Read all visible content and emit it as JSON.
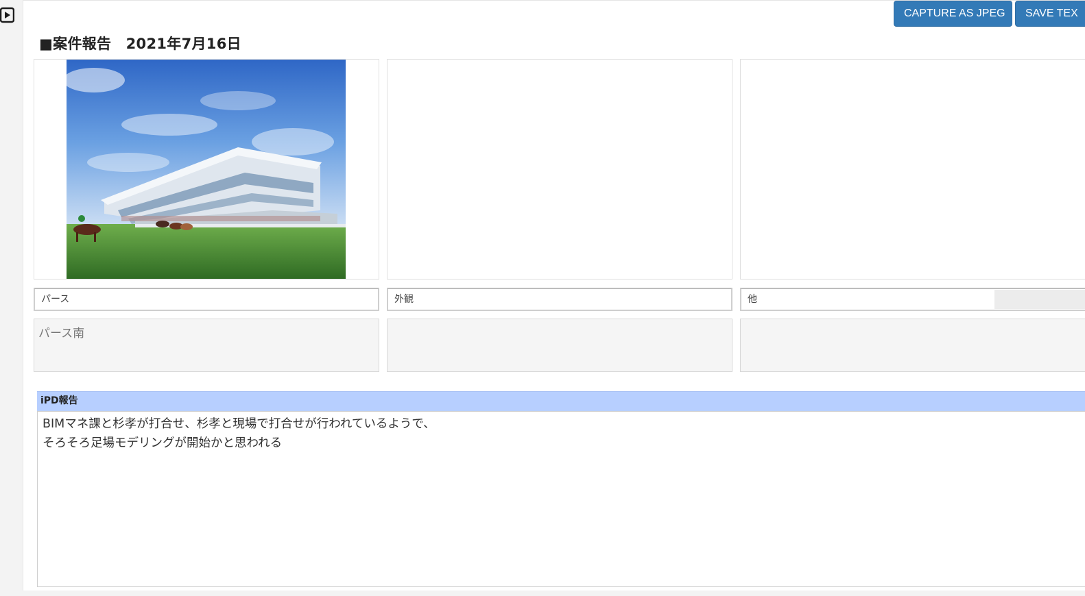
{
  "toolbar": {
    "capture_label": "CAPTURE AS JPEG",
    "save_label": "SAVE TEX"
  },
  "page": {
    "title": "■案件報告　2021年7月16日"
  },
  "panels": [
    {
      "caption": "パース",
      "description": "パース南",
      "image": "racecourse-grandstand-rendering"
    },
    {
      "caption": "外観",
      "description": "",
      "image": ""
    },
    {
      "caption": "他",
      "description": "",
      "image": ""
    }
  ],
  "report": {
    "header": "iPD報告",
    "body": "BIMマネ課と杉孝が打合せ、杉孝と現場で打合せが行われているようで、\nそろそろ足場モデリングが開始かと思われる"
  },
  "colors": {
    "button_bg": "#337ab7",
    "report_header_bg": "#b7cfff"
  }
}
